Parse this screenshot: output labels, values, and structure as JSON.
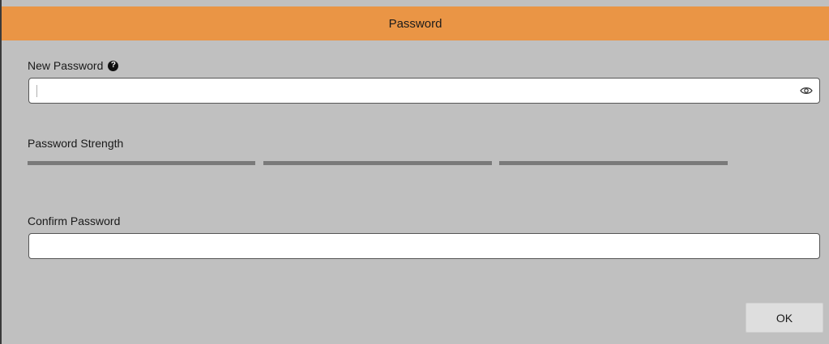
{
  "dialog": {
    "title": "Password",
    "new_password": {
      "label": "New Password",
      "help_icon": "question-circle-icon",
      "value": "",
      "reveal_icon": "eye-icon"
    },
    "strength": {
      "label": "Password Strength",
      "segments": 3
    },
    "confirm_password": {
      "label": "Confirm Password",
      "value": ""
    },
    "ok_label": "OK"
  },
  "colors": {
    "title_bar": "#ea9545",
    "background": "#c0c0c0",
    "strength_segment": "#7a7a7a"
  }
}
